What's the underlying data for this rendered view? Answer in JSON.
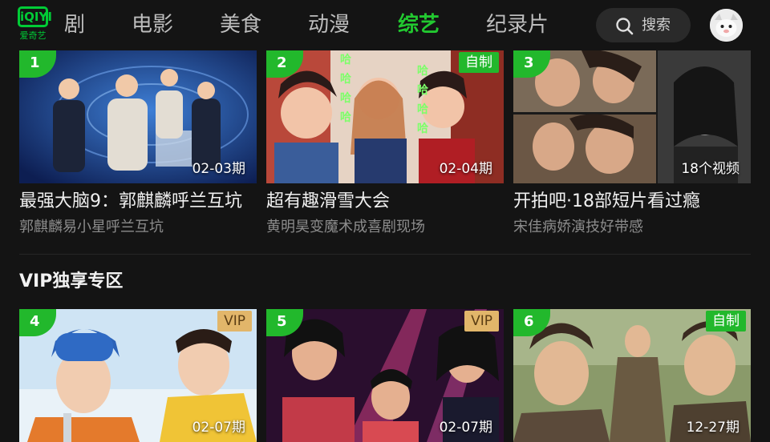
{
  "nav": {
    "logo_text": "iQIYI",
    "logo_sub": "爱奇艺",
    "items": [
      "剧",
      "电影",
      "美食",
      "动漫",
      "综艺",
      "纪录片"
    ],
    "active_index": 4,
    "search_label": "搜索",
    "accent_color": "#22c930"
  },
  "rows": [
    {
      "cards": [
        {
          "rank": "1",
          "badge": "",
          "episode": "02-03期",
          "title": "最强大脑9：郭麒麟呼兰互坑",
          "subtitle": "郭麒麟易小星呼兰互坑"
        },
        {
          "rank": "2",
          "badge": "自制",
          "episode": "02-04期",
          "title": "超有趣滑雪大会",
          "subtitle": "黄明昊变魔术成喜剧现场"
        },
        {
          "rank": "3",
          "badge": "",
          "episode": "18个视频",
          "title": "开拍吧·18部短片看过瘾",
          "subtitle": "宋佳病娇演技好带感"
        }
      ]
    },
    {
      "section_title": "VIP独享专区",
      "cards": [
        {
          "rank": "4",
          "badge": "VIP",
          "episode": "02-07期"
        },
        {
          "rank": "5",
          "badge": "VIP",
          "episode": "02-07期"
        },
        {
          "rank": "6",
          "badge": "自制",
          "episode": "12-27期"
        }
      ]
    }
  ]
}
